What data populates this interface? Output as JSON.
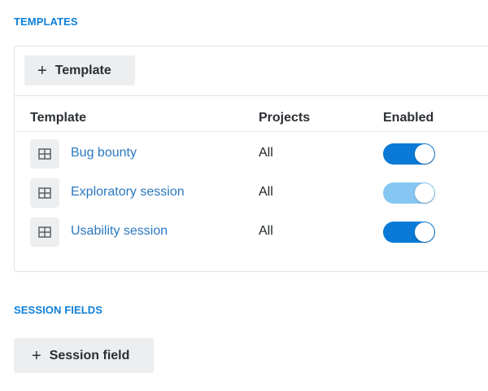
{
  "templates_section": {
    "title": "TEMPLATES",
    "add_button_label": "Template",
    "columns": {
      "template": "Template",
      "projects": "Projects",
      "enabled": "Enabled"
    },
    "rows": [
      {
        "name": "Bug bounty",
        "projects": "All",
        "enabled": true,
        "toggle_color": "#0a7ad6"
      },
      {
        "name": "Exploratory session",
        "projects": "All",
        "enabled": true,
        "toggle_color": "#86c6f2"
      },
      {
        "name": "Usability session",
        "projects": "All",
        "enabled": true,
        "toggle_color": "#0a7ad6"
      }
    ]
  },
  "session_fields_section": {
    "title": "SESSION FIELDS",
    "add_button_label": "Session field"
  },
  "icons": {
    "plus": "plus-icon",
    "template": "template-grid-icon"
  },
  "colors": {
    "accent": "#0f7fd8",
    "link": "#2a78bf",
    "toggle_on": "#0a7ad6",
    "toggle_on_light": "#86c6f2",
    "button_bg": "#eceef0"
  }
}
